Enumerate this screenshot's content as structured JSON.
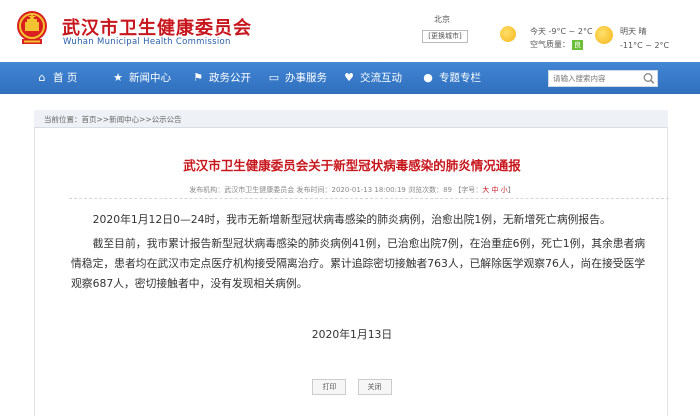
{
  "header": {
    "title_cn": "武汉市卫生健康委员会",
    "title_en": "Wuhan Municipal Health Commission",
    "weather": {
      "city": "北京",
      "switch_city": "[更换城市]",
      "today_temp": "今天 -9°C ~ 2°C",
      "air_quality_label": "空气质量：",
      "air_quality_value": "良",
      "tomorrow_label": "明天  晴",
      "tomorrow_temp": "-11°C ~ 2°C"
    }
  },
  "nav": {
    "items": [
      {
        "label": "首  页",
        "icon": "home-icon"
      },
      {
        "label": "新闻中心",
        "icon": "star-icon"
      },
      {
        "label": "政务公开",
        "icon": "bookmark-icon"
      },
      {
        "label": "办事服务",
        "icon": "desktop-icon"
      },
      {
        "label": "交流互动",
        "icon": "heart-icon"
      },
      {
        "label": "专题专栏",
        "icon": "chat-icon"
      }
    ],
    "search_placeholder": "请输入搜索内容"
  },
  "breadcrumb": "当前位置：首页>>新闻中心>>公示公告",
  "article": {
    "title": "武汉市卫生健康委员会关于新型冠状病毒感染的肺炎情况通报",
    "meta_prefix": "发布机构：武汉市卫生健康委员会  发布时间：2020-01-13 18:00:19  浏览次数：89  【字号：",
    "meta_sizes": "大 中 小",
    "meta_suffix": "】",
    "paragraph1": "2020年1月12日0—24时，我市无新增新型冠状病毒感染的肺炎病例，治愈出院1例，无新增死亡病例报告。",
    "paragraph2": "截至目前，我市累计报告新型冠状病毒感染的肺炎病例41例，已治愈出院7例，在治重症6例，死亡1例，其余患者病情稳定，患者均在武汉市定点医疗机构接受隔离治疗。累计追踪密切接触者763人，已解除医学观察76人，尚在接受医学观察687人，密切接触者中，没有发现相关病例。",
    "date": "2020年1月13日",
    "print_label": "打印",
    "close_label": "关闭"
  },
  "colors": {
    "brand_red": "#c8161d",
    "nav_blue": "#2f6fbe",
    "english_blue": "#2a5fa8"
  }
}
